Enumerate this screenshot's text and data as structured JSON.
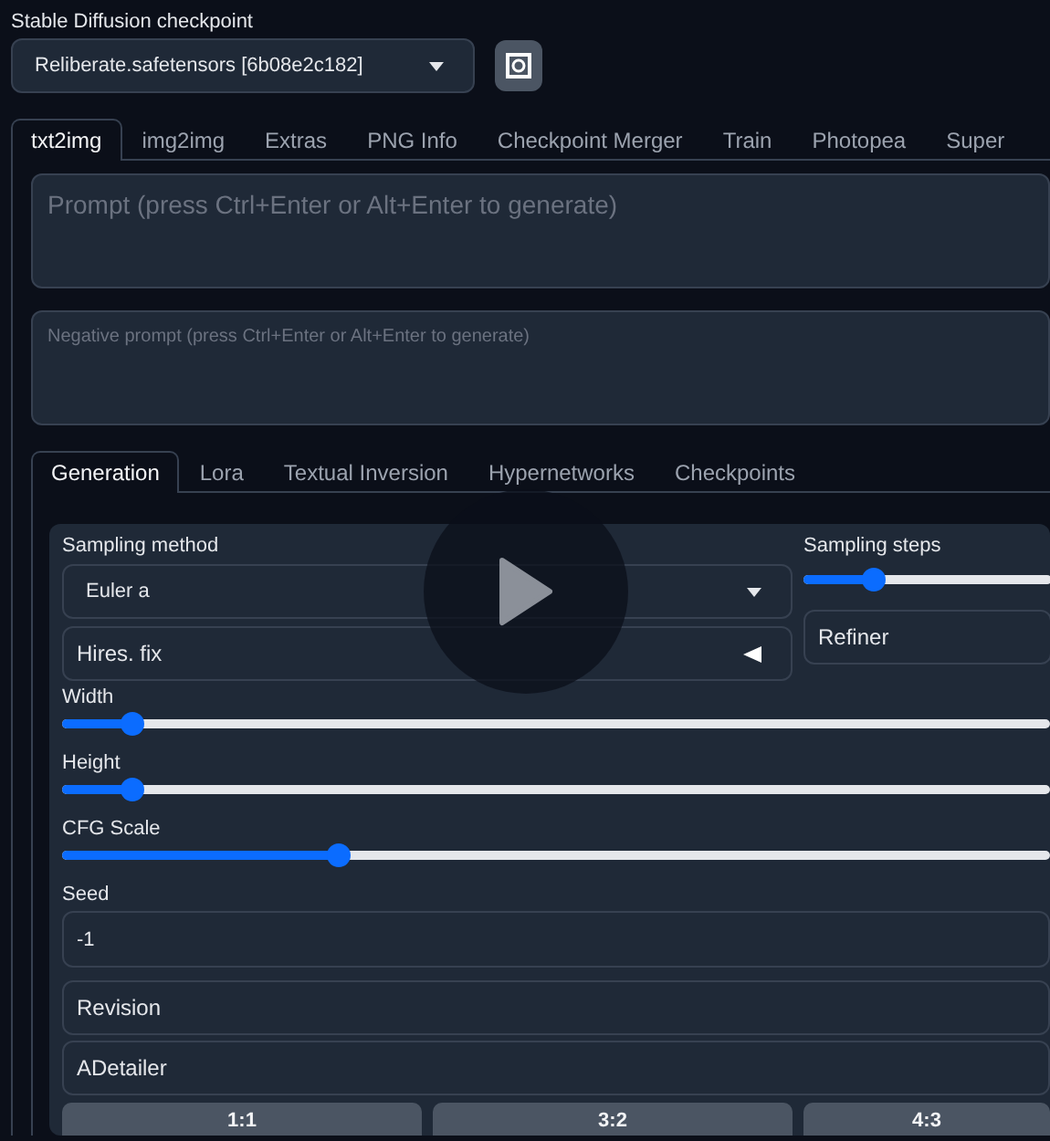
{
  "checkpoint": {
    "label": "Stable Diffusion checkpoint",
    "value": "Reliberate.safetensors [6b08e2c182]"
  },
  "tabs": [
    {
      "label": "txt2img",
      "selected": true
    },
    {
      "label": "img2img",
      "selected": false
    },
    {
      "label": "Extras",
      "selected": false
    },
    {
      "label": "PNG Info",
      "selected": false
    },
    {
      "label": "Checkpoint Merger",
      "selected": false
    },
    {
      "label": "Train",
      "selected": false
    },
    {
      "label": "Photopea",
      "selected": false
    },
    {
      "label": "Super",
      "selected": false
    }
  ],
  "prompt": {
    "placeholder": "Prompt (press Ctrl+Enter or Alt+Enter to generate)"
  },
  "negative_prompt": {
    "placeholder": "Negative prompt (press Ctrl+Enter or Alt+Enter to generate)"
  },
  "subtabs": [
    {
      "label": "Generation",
      "selected": true
    },
    {
      "label": "Lora",
      "selected": false
    },
    {
      "label": "Textual Inversion",
      "selected": false
    },
    {
      "label": "Hypernetworks",
      "selected": false
    },
    {
      "label": "Checkpoints",
      "selected": false
    }
  ],
  "sampling_method": {
    "label": "Sampling method",
    "value": "Euler a"
  },
  "sampling_steps": {
    "label": "Sampling steps",
    "level": 0.28
  },
  "hires_fix": {
    "label": "Hires. fix",
    "expanded": false
  },
  "refiner": {
    "label": "Refiner"
  },
  "sliders": [
    {
      "label": "Width",
      "level": 0.07
    },
    {
      "label": "Height",
      "level": 0.07
    },
    {
      "label": "CFG Scale",
      "level": 0.28
    }
  ],
  "seed": {
    "label": "Seed",
    "value": "-1"
  },
  "accordions": [
    "Revision",
    "ADetailer"
  ],
  "ratio_buttons": [
    "1:1",
    "3:2",
    "4:3"
  ]
}
